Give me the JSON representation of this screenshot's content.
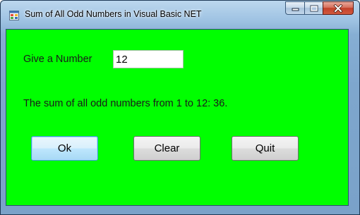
{
  "window": {
    "title": "Sum of All Odd Numbers in Visual Basic NET",
    "app_icon": "winforms-app-icon",
    "caption_icons": [
      "minimize-icon",
      "maximize-icon",
      "close-icon"
    ]
  },
  "form": {
    "background": "#00ff00",
    "prompt_label": "Give a Number",
    "number_value": "12",
    "result_text": "The sum of all odd numbers from 1 to 12: 36."
  },
  "buttons": {
    "ok_label": "Ok",
    "clear_label": "Clear",
    "quit_label": "Quit"
  }
}
